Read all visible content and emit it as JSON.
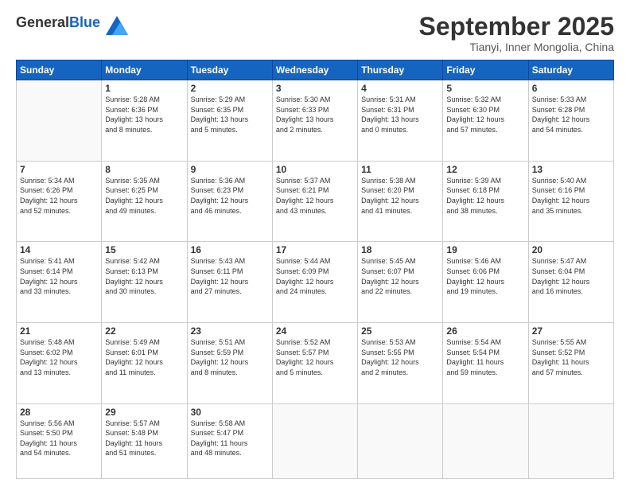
{
  "header": {
    "logo_general": "General",
    "logo_blue": "Blue",
    "month_title": "September 2025",
    "location": "Tianyi, Inner Mongolia, China"
  },
  "weekdays": [
    "Sunday",
    "Monday",
    "Tuesday",
    "Wednesday",
    "Thursday",
    "Friday",
    "Saturday"
  ],
  "weeks": [
    [
      {
        "day": "",
        "info": ""
      },
      {
        "day": "1",
        "info": "Sunrise: 5:28 AM\nSunset: 6:36 PM\nDaylight: 13 hours\nand 8 minutes."
      },
      {
        "day": "2",
        "info": "Sunrise: 5:29 AM\nSunset: 6:35 PM\nDaylight: 13 hours\nand 5 minutes."
      },
      {
        "day": "3",
        "info": "Sunrise: 5:30 AM\nSunset: 6:33 PM\nDaylight: 13 hours\nand 2 minutes."
      },
      {
        "day": "4",
        "info": "Sunrise: 5:31 AM\nSunset: 6:31 PM\nDaylight: 13 hours\nand 0 minutes."
      },
      {
        "day": "5",
        "info": "Sunrise: 5:32 AM\nSunset: 6:30 PM\nDaylight: 12 hours\nand 57 minutes."
      },
      {
        "day": "6",
        "info": "Sunrise: 5:33 AM\nSunset: 6:28 PM\nDaylight: 12 hours\nand 54 minutes."
      }
    ],
    [
      {
        "day": "7",
        "info": "Sunrise: 5:34 AM\nSunset: 6:26 PM\nDaylight: 12 hours\nand 52 minutes."
      },
      {
        "day": "8",
        "info": "Sunrise: 5:35 AM\nSunset: 6:25 PM\nDaylight: 12 hours\nand 49 minutes."
      },
      {
        "day": "9",
        "info": "Sunrise: 5:36 AM\nSunset: 6:23 PM\nDaylight: 12 hours\nand 46 minutes."
      },
      {
        "day": "10",
        "info": "Sunrise: 5:37 AM\nSunset: 6:21 PM\nDaylight: 12 hours\nand 43 minutes."
      },
      {
        "day": "11",
        "info": "Sunrise: 5:38 AM\nSunset: 6:20 PM\nDaylight: 12 hours\nand 41 minutes."
      },
      {
        "day": "12",
        "info": "Sunrise: 5:39 AM\nSunset: 6:18 PM\nDaylight: 12 hours\nand 38 minutes."
      },
      {
        "day": "13",
        "info": "Sunrise: 5:40 AM\nSunset: 6:16 PM\nDaylight: 12 hours\nand 35 minutes."
      }
    ],
    [
      {
        "day": "14",
        "info": "Sunrise: 5:41 AM\nSunset: 6:14 PM\nDaylight: 12 hours\nand 33 minutes."
      },
      {
        "day": "15",
        "info": "Sunrise: 5:42 AM\nSunset: 6:13 PM\nDaylight: 12 hours\nand 30 minutes."
      },
      {
        "day": "16",
        "info": "Sunrise: 5:43 AM\nSunset: 6:11 PM\nDaylight: 12 hours\nand 27 minutes."
      },
      {
        "day": "17",
        "info": "Sunrise: 5:44 AM\nSunset: 6:09 PM\nDaylight: 12 hours\nand 24 minutes."
      },
      {
        "day": "18",
        "info": "Sunrise: 5:45 AM\nSunset: 6:07 PM\nDaylight: 12 hours\nand 22 minutes."
      },
      {
        "day": "19",
        "info": "Sunrise: 5:46 AM\nSunset: 6:06 PM\nDaylight: 12 hours\nand 19 minutes."
      },
      {
        "day": "20",
        "info": "Sunrise: 5:47 AM\nSunset: 6:04 PM\nDaylight: 12 hours\nand 16 minutes."
      }
    ],
    [
      {
        "day": "21",
        "info": "Sunrise: 5:48 AM\nSunset: 6:02 PM\nDaylight: 12 hours\nand 13 minutes."
      },
      {
        "day": "22",
        "info": "Sunrise: 5:49 AM\nSunset: 6:01 PM\nDaylight: 12 hours\nand 11 minutes."
      },
      {
        "day": "23",
        "info": "Sunrise: 5:51 AM\nSunset: 5:59 PM\nDaylight: 12 hours\nand 8 minutes."
      },
      {
        "day": "24",
        "info": "Sunrise: 5:52 AM\nSunset: 5:57 PM\nDaylight: 12 hours\nand 5 minutes."
      },
      {
        "day": "25",
        "info": "Sunrise: 5:53 AM\nSunset: 5:55 PM\nDaylight: 12 hours\nand 2 minutes."
      },
      {
        "day": "26",
        "info": "Sunrise: 5:54 AM\nSunset: 5:54 PM\nDaylight: 11 hours\nand 59 minutes."
      },
      {
        "day": "27",
        "info": "Sunrise: 5:55 AM\nSunset: 5:52 PM\nDaylight: 11 hours\nand 57 minutes."
      }
    ],
    [
      {
        "day": "28",
        "info": "Sunrise: 5:56 AM\nSunset: 5:50 PM\nDaylight: 11 hours\nand 54 minutes."
      },
      {
        "day": "29",
        "info": "Sunrise: 5:57 AM\nSunset: 5:48 PM\nDaylight: 11 hours\nand 51 minutes."
      },
      {
        "day": "30",
        "info": "Sunrise: 5:58 AM\nSunset: 5:47 PM\nDaylight: 11 hours\nand 48 minutes."
      },
      {
        "day": "",
        "info": ""
      },
      {
        "day": "",
        "info": ""
      },
      {
        "day": "",
        "info": ""
      },
      {
        "day": "",
        "info": ""
      }
    ]
  ]
}
